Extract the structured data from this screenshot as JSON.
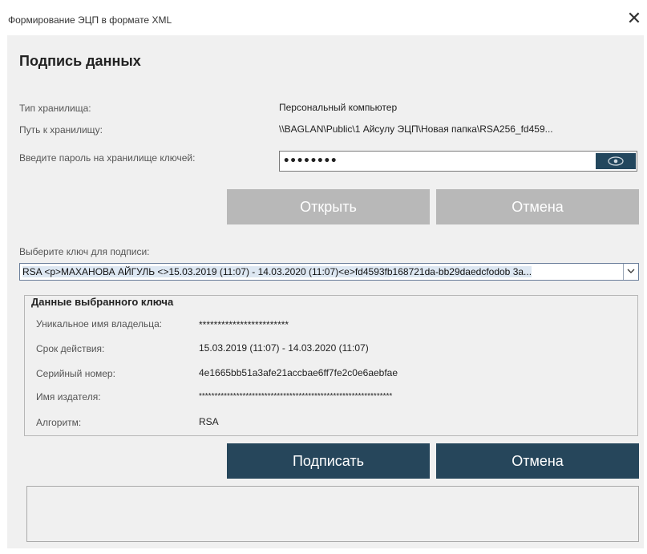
{
  "window": {
    "title": "Формирование ЭЦП в формате XML",
    "close_glyph": "✕"
  },
  "heading": "Подпись данных",
  "storage": {
    "type_label": "Тип хранилища:",
    "type_value": "Персональный компьютер",
    "path_label": "Путь к хранилищу:",
    "path_value": "\\\\BAGLAN\\Public\\1 Айсулу ЭЦП\\Новая папка\\RSA256_fd459...",
    "password_label": "Введите пароль на хранилище ключей:",
    "password_value": "••••••••",
    "eye_icon": "eye-icon"
  },
  "buttons": {
    "open": "Открыть",
    "cancel_top": "Отмена",
    "sign": "Подписать",
    "cancel_bottom": "Отмена"
  },
  "key_select": {
    "label": "Выберите ключ для подписи:",
    "selected": "RSA <p>МАХАНОВА АЙГУЛЬ <>15.03.2019 (11:07) - 14.03.2020 (11:07)<e>fd4593fb168721da-bb29daedcfodob 3a...",
    "arrow_icon": "chevron-down-icon"
  },
  "key_details": {
    "legend": "Данные выбранного ключа",
    "owner_label": "Уникальное имя владельца:",
    "owner_value": "************************",
    "validity_label": "Срок действия:",
    "validity_value": "15.03.2019 (11:07) - 14.03.2020 (11:07)",
    "serial_label": "Серийный номер:",
    "serial_value": "4e1665bb51a3afe21accbae6ff7fe2c0e6aebfae",
    "issuer_label": "Имя издателя:",
    "issuer_value": "**************************************************************",
    "algorithm_label": "Алгоритм:",
    "algorithm_value": "RSA"
  },
  "colors": {
    "primary_button": "#26465b",
    "disabled_button": "#b8b8b8",
    "panel_background": "#f0f0f0"
  }
}
